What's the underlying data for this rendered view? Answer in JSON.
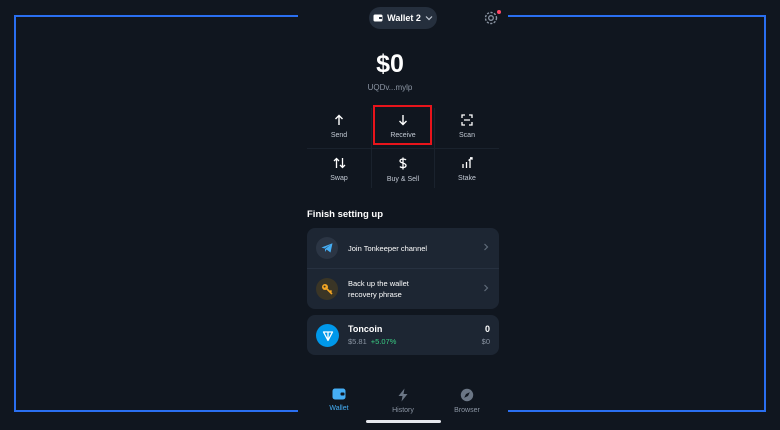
{
  "header": {
    "wallet_name": "Wallet 2",
    "settings_badge_color": "#ff4766"
  },
  "balance": {
    "amount": "$0",
    "address": "UQDv...mylp"
  },
  "actions": [
    {
      "label": "Send",
      "icon": "arrow-up-icon"
    },
    {
      "label": "Receive",
      "icon": "arrow-down-icon"
    },
    {
      "label": "Scan",
      "icon": "scan-icon"
    },
    {
      "label": "Swap",
      "icon": "swap-icon"
    },
    {
      "label": "Buy & Sell",
      "icon": "dollar-icon"
    },
    {
      "label": "Stake",
      "icon": "stake-icon"
    }
  ],
  "setup": {
    "title": "Finish setting up",
    "items": [
      {
        "label": "Join Tonkeeper channel",
        "icon": "telegram-icon"
      },
      {
        "label_line1": "Back up the wallet",
        "label_line2": "recovery phrase",
        "icon": "key-icon"
      }
    ]
  },
  "token": {
    "name": "Toncoin",
    "price": "$5.81",
    "change": "+5.07%",
    "amount": "0",
    "fiat": "$0"
  },
  "tabbar": [
    {
      "label": "Wallet",
      "icon": "wallet-icon",
      "active": true
    },
    {
      "label": "History",
      "icon": "lightning-icon",
      "active": false
    },
    {
      "label": "Browser",
      "icon": "compass-icon",
      "active": false
    }
  ],
  "colors": {
    "accent": "#45aef5",
    "highlight": "#e8141b",
    "positive": "#39cc83",
    "ton_blue": "#0098ea"
  }
}
